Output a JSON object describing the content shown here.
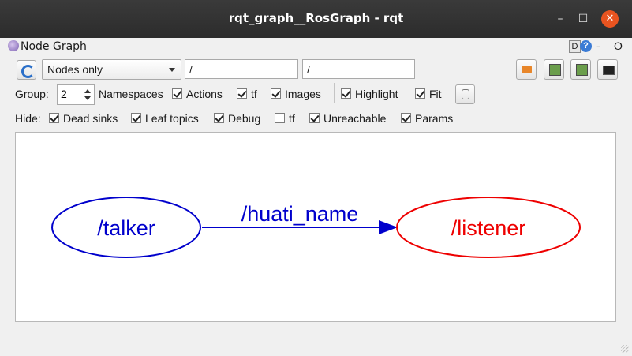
{
  "window": {
    "title": "rqt_graph__RosGraph - rqt",
    "minimize": "–",
    "maximize": "☐",
    "close": "✕"
  },
  "plugin": {
    "title": "Node Graph",
    "d_label": "D",
    "help": "?",
    "dash": "-",
    "o_label": "O"
  },
  "toolbar": {
    "graph_mode": "Nodes only",
    "filter_node": "/",
    "filter_topic": "/"
  },
  "group": {
    "label": "Group:",
    "value": "2",
    "namespaces": {
      "label": "Namespaces",
      "checked": true
    },
    "actions": {
      "label": "Actions",
      "checked": true
    },
    "tf": {
      "label": "tf",
      "checked": true
    },
    "images": {
      "label": "Images",
      "checked": true
    },
    "highlight": {
      "label": "Highlight",
      "checked": true
    },
    "fit": {
      "label": "Fit",
      "checked": true
    }
  },
  "hide": {
    "label": "Hide:",
    "dead_sinks": {
      "label": "Dead sinks",
      "checked": true
    },
    "leaf_topics": {
      "label": "Leaf topics",
      "checked": true
    },
    "debug": {
      "label": "Debug",
      "checked": true
    },
    "tf": {
      "label": "tf",
      "checked": false
    },
    "unreachable": {
      "label": "Unreachable",
      "checked": true
    },
    "params": {
      "label": "Params",
      "checked": true
    }
  },
  "graph": {
    "source_node": "/talker",
    "target_node": "/listener",
    "edge_topic": "/huati_name",
    "source_color": "#0000cc",
    "target_color": "#ee0000"
  }
}
